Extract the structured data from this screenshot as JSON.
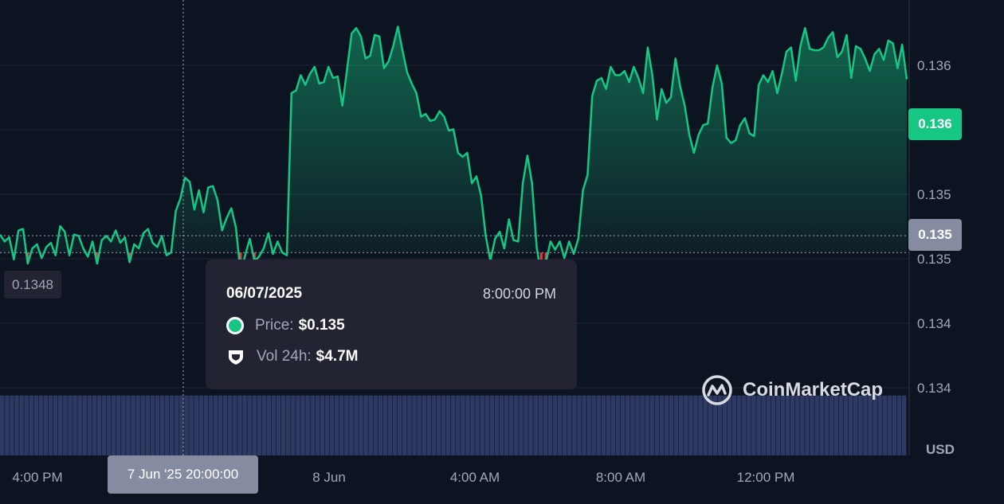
{
  "chart_data": {
    "type": "area",
    "x_ticks": [
      "4:00 PM",
      "8 Jun",
      "4:00 AM",
      "8:00 AM",
      "12:00 PM"
    ],
    "y_ticks": [
      "0.136",
      "0.135",
      "0.135",
      "0.134",
      "0.134"
    ],
    "y_unit": "USD",
    "start_price_label": "0.1348",
    "current_price_label": "0.136",
    "hover_price_label": "0.135",
    "crosshair_time_label": "7 Jun '25 20:00:00",
    "line_color": "#16c784",
    "below_open_color": "#ea3943",
    "volume_color": "#2f3a64",
    "ylim": [
      0.13375,
      0.13645
    ],
    "price_series": [
      0.13493,
      0.13488,
      0.13491,
      0.13475,
      0.13496,
      0.13497,
      0.13472,
      0.13483,
      0.13486,
      0.13476,
      0.13484,
      0.13487,
      0.13478,
      0.13499,
      0.13495,
      0.13478,
      0.13493,
      0.13492,
      0.13483,
      0.13477,
      0.13488,
      0.13472,
      0.13489,
      0.13492,
      0.13488,
      0.13496,
      0.13487,
      0.13491,
      0.13473,
      0.13486,
      0.13483,
      0.13494,
      0.13497,
      0.13487,
      0.13484,
      0.13492,
      0.13478,
      0.1348,
      0.1351,
      0.13519,
      0.13534,
      0.13531,
      0.13511,
      0.13525,
      0.13509,
      0.13527,
      0.13528,
      0.13518,
      0.13496,
      0.13505,
      0.13512,
      0.13498,
      0.13465,
      0.13478,
      0.1349,
      0.13474,
      0.13477,
      0.13483,
      0.13494,
      0.13479,
      0.13488,
      0.1348,
      0.13478,
      0.13595,
      0.13597,
      0.13608,
      0.13601,
      0.13609,
      0.13614,
      0.13602,
      0.13603,
      0.13614,
      0.13606,
      0.13607,
      0.13586,
      0.13612,
      0.13638,
      0.13642,
      0.13636,
      0.1362,
      0.13622,
      0.13637,
      0.13636,
      0.13613,
      0.13618,
      0.13629,
      0.13643,
      0.13626,
      0.1361,
      0.13602,
      0.13595,
      0.13578,
      0.1358,
      0.13575,
      0.13576,
      0.13582,
      0.13578,
      0.13568,
      0.13569,
      0.13552,
      0.13549,
      0.13552,
      0.1353,
      0.13535,
      0.13521,
      0.13492,
      0.13474,
      0.1349,
      0.13495,
      0.13483,
      0.13504,
      0.13489,
      0.13488,
      0.1353,
      0.1355,
      0.1353,
      0.13484,
      0.13463,
      0.13473,
      0.13488,
      0.13482,
      0.13488,
      0.13476,
      0.13488,
      0.13479,
      0.1349,
      0.13525,
      0.13536,
      0.13593,
      0.13604,
      0.13606,
      0.13598,
      0.13614,
      0.13608,
      0.13608,
      0.13611,
      0.13603,
      0.13614,
      0.13606,
      0.13595,
      0.13628,
      0.13608,
      0.13576,
      0.13598,
      0.13588,
      0.13592,
      0.1362,
      0.136,
      0.13586,
      0.13565,
      0.13552,
      0.13565,
      0.13572,
      0.13573,
      0.13599,
      0.13615,
      0.13602,
      0.13563,
      0.13559,
      0.13561,
      0.13572,
      0.13577,
      0.13566,
      0.13564,
      0.13601,
      0.13608,
      0.13603,
      0.13611,
      0.13595,
      0.13609,
      0.13625,
      0.13628,
      0.13604,
      0.13629,
      0.13642,
      0.13627,
      0.13626,
      0.13626,
      0.13628,
      0.13635,
      0.13639,
      0.13621,
      0.13625,
      0.13637,
      0.13606,
      0.13629,
      0.13627,
      0.1362,
      0.13611,
      0.13623,
      0.13627,
      0.13619,
      0.13633,
      0.13631,
      0.13613,
      0.1363,
      0.13605
    ],
    "volume_series": [
      0.86,
      0.86,
      0.86,
      0.86,
      0.86,
      0.86,
      0.86,
      0.86,
      0.86,
      0.86,
      0.86,
      0.86,
      0.86,
      0.86,
      0.86,
      0.86,
      0.86,
      0.86,
      0.86,
      0.86,
      0.86,
      0.86,
      0.86,
      0.86,
      0.86,
      0.86,
      0.86,
      0.86,
      0.86,
      0.86,
      0.86,
      0.86,
      0.86,
      0.86,
      0.86,
      0.86,
      0.86,
      0.86,
      0.86,
      0.86,
      0.86,
      0.86,
      0.86,
      0.86,
      0.86,
      0.86,
      0.86,
      0.86,
      0.86,
      0.86,
      0.86,
      0.86,
      0.86,
      0.86,
      0.86,
      0.86,
      0.86,
      0.86,
      0.86,
      0.86,
      0.86,
      0.86,
      0.86,
      0.86,
      0.86,
      0.86,
      0.86,
      0.86,
      0.86,
      0.86,
      0.86,
      0.86,
      0.86,
      0.86,
      0.86,
      0.86,
      0.86,
      0.86,
      0.86,
      0.86,
      0.86,
      0.86,
      0.86,
      0.86,
      0.86,
      0.86,
      0.86,
      0.86,
      0.86,
      0.86,
      0.86,
      0.86,
      0.86,
      0.86,
      0.86,
      0.86,
      0.86,
      0.86,
      0.86,
      0.86,
      0.86,
      0.86,
      0.86,
      0.86,
      0.86,
      0.86,
      0.86,
      0.86,
      0.86,
      0.86,
      0.86,
      0.86,
      0.86,
      0.86,
      0.86,
      0.86,
      0.86,
      0.86,
      0.86,
      0.86,
      0.86,
      0.86,
      0.86,
      0.86,
      0.86,
      0.86,
      0.86,
      0.86,
      0.86,
      0.86,
      0.86,
      0.86,
      0.86,
      0.86,
      0.86,
      0.86,
      0.86,
      0.86,
      0.86,
      0.86,
      0.86,
      0.86,
      0.86,
      0.86,
      0.86,
      0.86,
      0.86,
      0.86,
      0.86,
      0.86,
      0.86,
      0.86,
      0.86,
      0.86,
      0.86,
      0.86,
      0.86,
      0.86,
      0.86,
      0.86,
      0.86,
      0.86,
      0.86,
      0.86,
      0.86,
      0.86,
      0.86,
      0.86,
      0.86,
      0.86,
      0.86,
      0.86,
      0.86,
      0.86,
      0.86,
      0.86,
      0.86,
      0.86,
      0.86,
      0.86,
      0.86,
      0.86,
      0.86,
      0.86,
      0.86,
      0.86,
      0.86
    ]
  },
  "tooltip": {
    "date": "06/07/2025",
    "time": "8:00:00 PM",
    "price_label": "Price:",
    "price_value": "$0.135",
    "volume_label": "Vol 24h:",
    "volume_value": "$4.7M"
  },
  "watermark": {
    "brand": "CoinMarketCap"
  },
  "axis": {
    "unit_label": "USD"
  }
}
